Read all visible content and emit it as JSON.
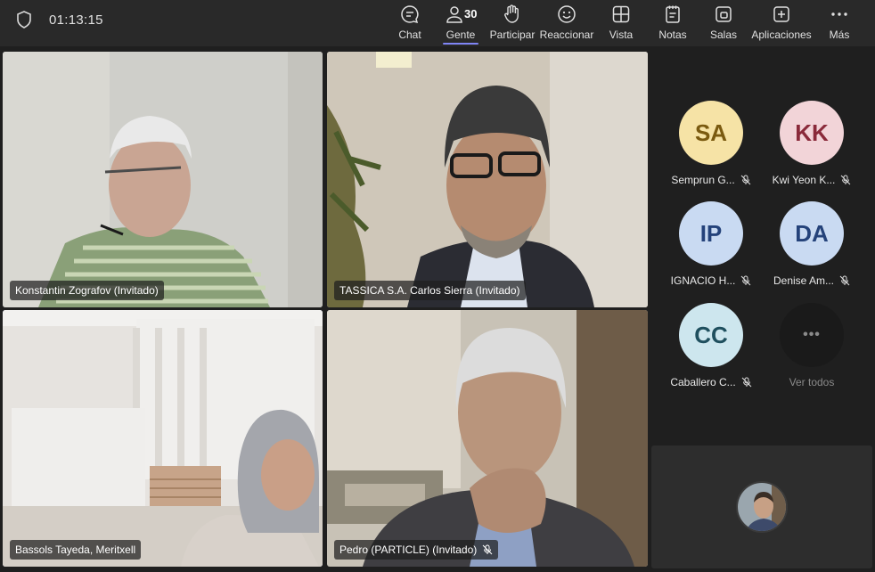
{
  "meeting": {
    "timer": "01:13:15",
    "people_count": "30"
  },
  "toolbar": {
    "chat": "Chat",
    "people": "Gente",
    "raise": "Participar",
    "react": "Reaccionar",
    "view": "Vista",
    "notes": "Notas",
    "rooms": "Salas",
    "apps": "Aplicaciones",
    "more": "Más"
  },
  "tiles": [
    {
      "name": "Konstantin Zografov (Invitado)"
    },
    {
      "name": "TASSICA S.A. Carlos Sierra (Invitado)"
    },
    {
      "name": "Bassols Tayeda, Meritxell"
    },
    {
      "name": "Pedro (PARTICLE) (Invitado)"
    }
  ],
  "roster": [
    {
      "initials": "SA",
      "name": "Semprun G...",
      "color": "#f6e3a6"
    },
    {
      "initials": "KK",
      "name": "Kwi Yeon K...",
      "color": "#f2d4d8"
    },
    {
      "initials": "IP",
      "name": "IGNACIO H...",
      "color": "#c9daf2"
    },
    {
      "initials": "DA",
      "name": "Denise Am...",
      "color": "#c9daf2"
    },
    {
      "initials": "CC",
      "name": "Caballero C...",
      "color": "#cde6ee"
    }
  ],
  "see_all": {
    "label": "Ver todos",
    "icon": "•••"
  },
  "colors": {
    "accent": "#7f85f5",
    "bar": "#292929",
    "bg": "#1f1f1f"
  }
}
